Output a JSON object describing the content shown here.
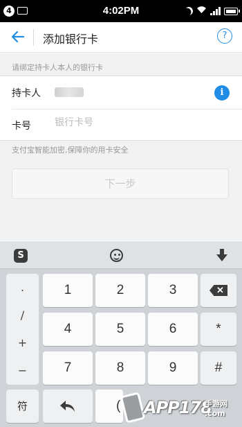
{
  "status_bar": {
    "notification_count": "4",
    "time": "4:02PM"
  },
  "header": {
    "title": "添加银行卡",
    "help_icon": "question-circle-icon"
  },
  "form": {
    "hint": "请绑定持卡人本人的银行卡",
    "cardholder_label": "持卡人",
    "card_number_label": "卡号",
    "card_number_placeholder": "银行卡号",
    "card_number_value": "",
    "safety_note": "支付宝智能加密,保障你的用卡安全",
    "next_button": "下一步"
  },
  "keyboard": {
    "ime_logo": "S",
    "symbols": [
      ".",
      "/",
      "+",
      "−"
    ],
    "digits": [
      "1",
      "2",
      "3",
      "4",
      "5",
      "6",
      "7",
      "8",
      "9"
    ],
    "star": "*",
    "hash": "#",
    "char_key": "符",
    "zero_partial": "(",
    "delete_icon": "backspace-icon",
    "hide_icon": "arrow-down-icon"
  },
  "watermark": {
    "brand": "APP178",
    "suffix_cn": "手游网",
    "suffix_domain": ".com"
  },
  "colors": {
    "accent": "#1f8de6",
    "keyboard_bg": "#cfd3d7"
  }
}
